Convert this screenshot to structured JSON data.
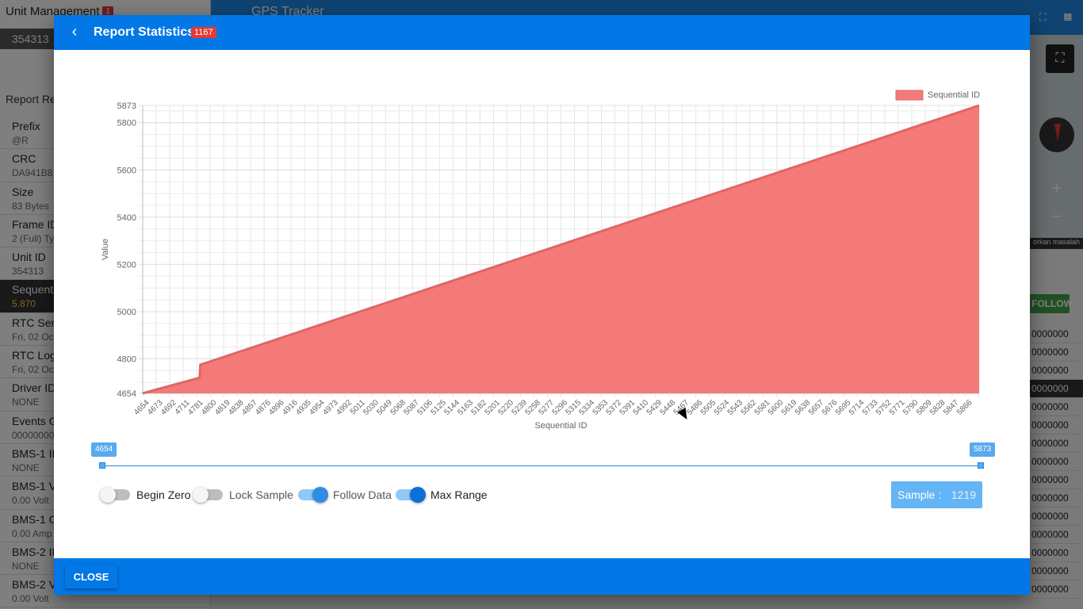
{
  "background": {
    "left_title": "Unit Management",
    "left_badge": "1",
    "unit_selected": "354313",
    "report_heading": "Report Re",
    "fields": [
      {
        "name": "Prefix",
        "value": "@R"
      },
      {
        "name": "CRC",
        "value": "DA941B8"
      },
      {
        "name": "Size",
        "value": "83 Bytes"
      },
      {
        "name": "Frame ID",
        "value": "2 (Full) Ty"
      },
      {
        "name": "Unit ID",
        "value": "354313"
      },
      {
        "name": "Sequent",
        "value": "5.870"
      },
      {
        "name": "RTC Sen",
        "value": "Fri, 02 Oc"
      },
      {
        "name": "RTC Log",
        "value": "Fri, 02 Oc"
      },
      {
        "name": "Driver ID",
        "value": "NONE"
      },
      {
        "name": "Events G",
        "value": "00000000"
      },
      {
        "name": "BMS-1 ID",
        "value": "NONE"
      },
      {
        "name": "BMS-1 V",
        "value": "0.00 Volt"
      },
      {
        "name": "BMS-1 C",
        "value": "0.00 Amp"
      },
      {
        "name": "BMS-2 ID",
        "value": "NONE"
      },
      {
        "name": "BMS-2 V",
        "value": "0.00 Volt"
      }
    ],
    "app_title": "GPS Tracker",
    "map_note": "orkan masalah",
    "follow_label": "FOLLOW",
    "codes": [
      "0000000",
      "0000000",
      "0000000",
      "0000000",
      "0000000",
      "0000000",
      "0000000",
      "0000000",
      "0000000",
      "0000000",
      "0000000",
      "0000000",
      "0000000",
      "0000000",
      "0000000"
    ]
  },
  "modal": {
    "title": "Report Statistics",
    "badge": "1167",
    "close_label": "CLOSE"
  },
  "range": {
    "min_label": "4654",
    "max_label": "5873"
  },
  "toggles": [
    {
      "label": "Begin Zero",
      "on": false
    },
    {
      "label": "Lock Sample",
      "on": false
    },
    {
      "label": "Follow Data",
      "on": true
    },
    {
      "label": "Max Range",
      "on": true
    }
  ],
  "sample": {
    "label": "Sample :",
    "value": "1219"
  },
  "colors": {
    "header": "#0277e6",
    "series_fill": "#f47a7a",
    "series_line": "#e06666"
  },
  "chart_data": {
    "type": "area",
    "title": "",
    "xlabel": "Sequential ID",
    "ylabel": "Value",
    "legend": {
      "position": "top-right"
    },
    "grid": true,
    "ylim": [
      4654,
      5873
    ],
    "yticks": [
      4654,
      4800,
      5000,
      5200,
      5400,
      5600,
      5800,
      5873
    ],
    "xticks": [
      "4654",
      "4673",
      "4692",
      "4711",
      "4781",
      "4800",
      "4819",
      "4838",
      "4857",
      "4876",
      "4896",
      "4916",
      "4935",
      "4954",
      "4973",
      "4992",
      "5011",
      "5030",
      "5049",
      "5068",
      "5087",
      "5106",
      "5125",
      "5144",
      "5163",
      "5182",
      "5201",
      "5220",
      "5239",
      "5258",
      "5277",
      "5296",
      "5315",
      "5334",
      "5353",
      "5372",
      "5391",
      "5410",
      "5429",
      "5448",
      "5467",
      "5486",
      "5505",
      "5524",
      "5543",
      "5562",
      "5581",
      "5600",
      "5619",
      "5638",
      "5657",
      "5676",
      "5695",
      "5714",
      "5733",
      "5752",
      "5771",
      "5790",
      "5809",
      "5828",
      "5847",
      "5866"
    ],
    "series": [
      {
        "name": "Sequential ID",
        "points": [
          {
            "x": 4654,
            "y": 4654
          },
          {
            "x": 4737,
            "y": 4720
          },
          {
            "x": 4738,
            "y": 4775
          },
          {
            "x": 5873,
            "y": 5873
          }
        ]
      }
    ]
  }
}
